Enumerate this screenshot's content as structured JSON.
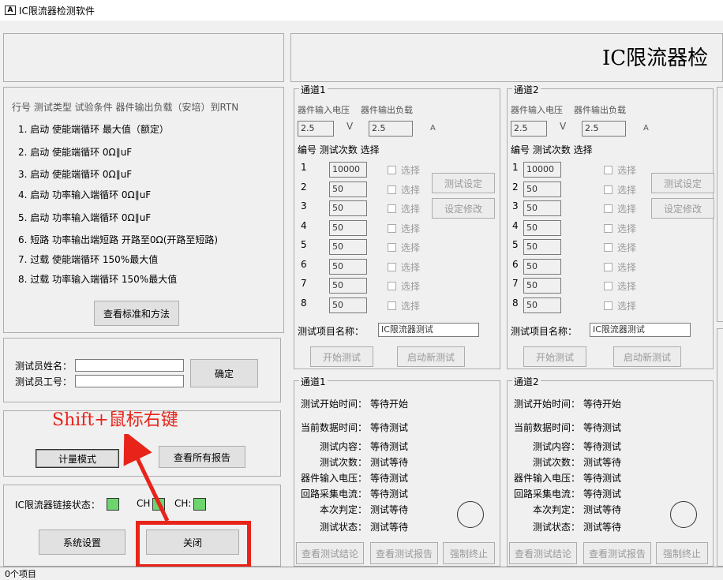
{
  "window": {
    "title": "IC限流器检测软件",
    "icon": "A"
  },
  "banner": {
    "title": "IC限流器检"
  },
  "test_list": {
    "header": "行号 测试类型 试验条件  器件输出负载（安培）到RTN",
    "rows": [
      "1. 启动   使能端循环      最大值（额定）",
      "2. 启动   使能端循环       0Ω∥uF",
      "3. 启动   使能端循环       0Ω∥uF",
      "4. 启动   功率输入端循环    0Ω∥uF",
      "5. 启动   功率输入端循环    0Ω∥uF",
      "6. 短路   功率输出端短路  开路至0Ω(开路至短路)",
      "7. 过载   使能端循环      150%最大值",
      "8. 过载   功率输入端循环    150%最大值"
    ],
    "view_standards_button": "查看标准和方法"
  },
  "tester": {
    "name_label": "测试员姓名：",
    "id_label": "测试员工号：",
    "confirm_button": "确定"
  },
  "mode": {
    "metering_button": "计量模式",
    "view_reports_button": "查看所有报告"
  },
  "link": {
    "label": "IC限流器链接状态：",
    "ch1": "CH",
    "ch2": "CH:"
  },
  "bottom": {
    "settings_button": "系统设置",
    "close_button": "关闭"
  },
  "annotation": {
    "text": "Shift+鼠标右键"
  },
  "channels": [
    {
      "title": "通道1",
      "input_voltage_label": "器件输入电压",
      "output_load_label": "器件输出负载",
      "voltage_value": "2.5",
      "voltage_unit": "V",
      "load_value": "2.5",
      "load_unit": "A",
      "table_header": "编号 测试次数  选择",
      "rows": [
        {
          "no": "1",
          "count": "10000",
          "select": "选择"
        },
        {
          "no": "2",
          "count": "50",
          "select": "选择"
        },
        {
          "no": "3",
          "count": "50",
          "select": "选择"
        },
        {
          "no": "4",
          "count": "50",
          "select": "选择"
        },
        {
          "no": "5",
          "count": "50",
          "select": "选择"
        },
        {
          "no": "6",
          "count": "50",
          "select": "选择"
        },
        {
          "no": "7",
          "count": "50",
          "select": "选择"
        },
        {
          "no": "8",
          "count": "50",
          "select": "选择"
        }
      ],
      "test_setup_button": "测试设定",
      "setup_modify_button": "设定修改",
      "item_name_label": "测试项目名称：",
      "item_name_value": "IC限流器测试",
      "start_button": "开始测试",
      "restart_button": "启动新测试"
    },
    {
      "title": "通道2",
      "input_voltage_label": "器件输入电压",
      "output_load_label": "器件输出负载",
      "voltage_value": "2.5",
      "voltage_unit": "V",
      "load_value": "2.5",
      "load_unit": "A",
      "table_header": "编号 测试次数  选择",
      "rows": [
        {
          "no": "1",
          "count": "10000",
          "select": "选择"
        },
        {
          "no": "2",
          "count": "50",
          "select": "选择"
        },
        {
          "no": "3",
          "count": "50",
          "select": "选择"
        },
        {
          "no": "4",
          "count": "50",
          "select": "选择"
        },
        {
          "no": "5",
          "count": "50",
          "select": "选择"
        },
        {
          "no": "6",
          "count": "50",
          "select": "选择"
        },
        {
          "no": "7",
          "count": "50",
          "select": "选择"
        },
        {
          "no": "8",
          "count": "50",
          "select": "选择"
        }
      ],
      "test_setup_button": "测试设定",
      "setup_modify_button": "设定修改",
      "item_name_label": "测试项目名称：",
      "item_name_value": "IC限流器测试",
      "start_button": "开始测试",
      "restart_button": "启动新测试"
    }
  ],
  "status": [
    {
      "title": "通道1",
      "lines": [
        {
          "label": "测试开始时间：",
          "value": "等待开始"
        },
        {
          "label": "当前数据时间：",
          "value": "等待测试"
        },
        {
          "label": "测试内容：",
          "value": "等待测试"
        },
        {
          "label": "测试次数：",
          "value": "测试等待"
        },
        {
          "label": "器件输入电压：",
          "value": "等待测试"
        },
        {
          "label": "回路采集电流：",
          "value": "等待测试"
        },
        {
          "label": "本次判定：",
          "value": "测试等待"
        },
        {
          "label": "测试状态：",
          "value": "测试等待"
        }
      ],
      "view_conclusion_button": "查看测试结论",
      "view_report_button": "查看测试报告",
      "force_stop_button": "强制终止"
    },
    {
      "title": "通道2",
      "lines": [
        {
          "label": "测试开始时间：",
          "value": "等待开始"
        },
        {
          "label": "当前数据时间：",
          "value": "等待测试"
        },
        {
          "label": "测试内容：",
          "value": "等待测试"
        },
        {
          "label": "测试次数：",
          "value": "测试等待"
        },
        {
          "label": "器件输入电压：",
          "value": "等待测试"
        },
        {
          "label": "回路采集电流：",
          "value": "等待测试"
        },
        {
          "label": "本次判定：",
          "value": "测试等待"
        },
        {
          "label": "测试状态：",
          "value": "测试等待"
        }
      ],
      "view_conclusion_button": "查看测试结论",
      "view_report_button": "查看测试报告",
      "force_stop_button": "强制终止"
    }
  ],
  "statusbar": {
    "text": "0个项目"
  },
  "colors": {
    "annotation_red": "#e8231a",
    "link_ok_green": "#6ed56e"
  }
}
